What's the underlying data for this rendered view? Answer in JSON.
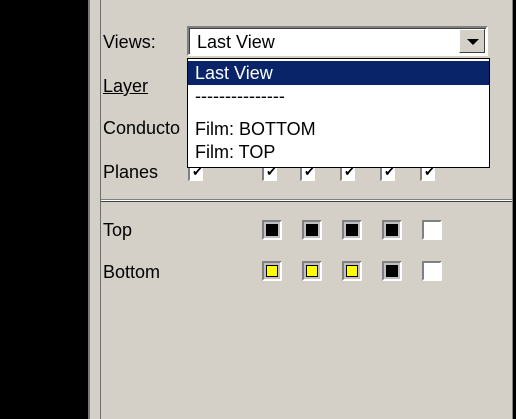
{
  "labels": {
    "views": "Views:",
    "layer": "Layer",
    "conductors": "Conducto",
    "planes": "Planes",
    "top": "Top",
    "bottom": "Bottom"
  },
  "views_combo": {
    "value": "Last View",
    "options": [
      "Last View",
      "---------------",
      "Film: BOTTOM",
      "Film: TOP"
    ],
    "selected_index": 0
  },
  "planes_checkboxes": [
    true,
    true,
    true,
    true,
    true,
    true
  ],
  "layer_colors": {
    "top": [
      "#000000",
      "#000000",
      "#000000",
      "#000000",
      "#ffffff"
    ],
    "bottom": [
      "#ffff00",
      "#ffff00",
      "#ffff00",
      "#000000",
      "#ffffff"
    ]
  },
  "colors": {
    "panel_bg": "#d4d0c8",
    "selection": "#0a246a"
  }
}
